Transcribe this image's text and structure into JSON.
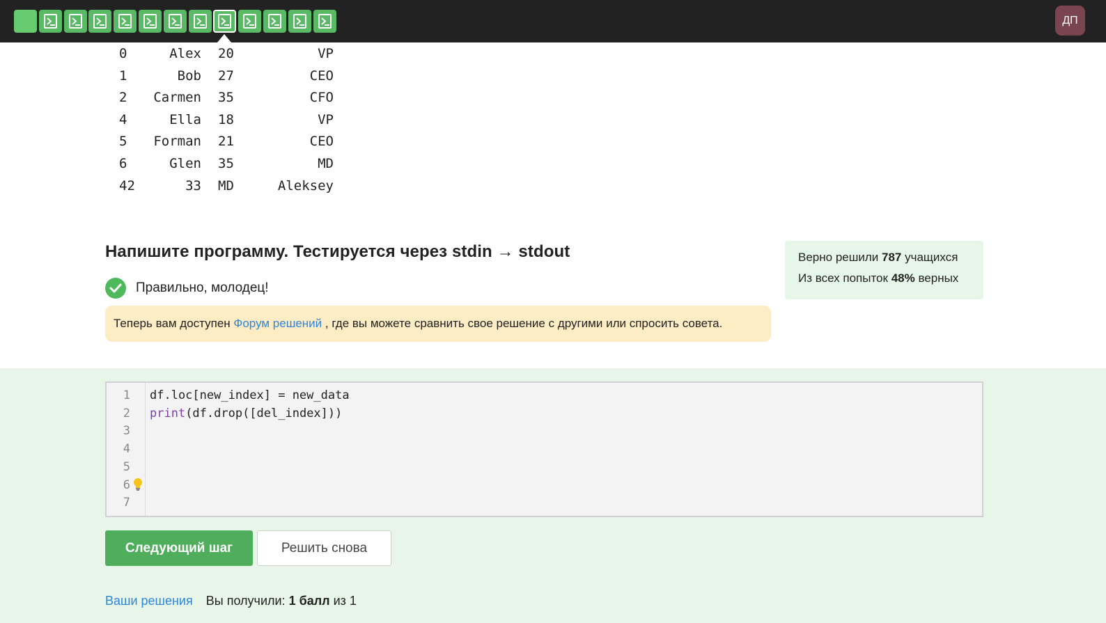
{
  "topbar": {
    "steps": [
      {
        "type": "done",
        "icon": "step-blank-icon"
      },
      {
        "type": "done",
        "icon": "terminal-icon"
      },
      {
        "type": "done",
        "icon": "terminal-icon"
      },
      {
        "type": "done",
        "icon": "terminal-icon"
      },
      {
        "type": "done",
        "icon": "terminal-icon"
      },
      {
        "type": "done",
        "icon": "terminal-icon"
      },
      {
        "type": "done",
        "icon": "terminal-icon"
      },
      {
        "type": "done",
        "icon": "terminal-icon"
      },
      {
        "type": "current",
        "icon": "terminal-icon"
      },
      {
        "type": "done",
        "icon": "terminal-icon"
      },
      {
        "type": "done",
        "icon": "terminal-icon"
      },
      {
        "type": "done",
        "icon": "terminal-icon"
      },
      {
        "type": "done",
        "icon": "terminal-icon"
      }
    ],
    "avatar_initials": "ДП"
  },
  "output_table": {
    "rows": [
      [
        "0",
        "Alex",
        "20",
        "VP"
      ],
      [
        "1",
        "Bob",
        "27",
        "CEO"
      ],
      [
        "2",
        "Carmen",
        "35",
        "CFO"
      ],
      [
        "4",
        "Ella",
        "18",
        "VP"
      ],
      [
        "5",
        "Forman",
        "21",
        "CEO"
      ],
      [
        "6",
        "Glen",
        "35",
        "MD"
      ],
      [
        "42",
        "33",
        "MD",
        "Aleksey"
      ]
    ]
  },
  "task": {
    "title": "Напишите программу. Тестируется через stdin → stdout",
    "result_text": "Правильно, молодец!",
    "notice_before": "Теперь вам доступен",
    "notice_link": "Форум решений",
    "notice_after": ", где вы можете сравнить свое решение с другими или спросить совета."
  },
  "stats": {
    "solved_prefix": "Верно решили",
    "solved_count": "787",
    "solved_suffix": "учащихся",
    "attempts_prefix": "Из всех попыток",
    "attempts_percent": "48%",
    "attempts_suffix": "верных"
  },
  "editor": {
    "line_numbers": [
      "1",
      "2",
      "3",
      "4",
      "5",
      "6",
      "7"
    ],
    "lines": [
      {
        "kw": "",
        "rest": "df.loc[new_index] = new_data"
      },
      {
        "kw": "print",
        "rest": "(df.drop([del_index]))"
      }
    ]
  },
  "buttons": {
    "next_step": "Следующий шаг",
    "solve_again": "Решить снова"
  },
  "footer": {
    "your_solutions": "Ваши решения",
    "received_prefix": "Вы получили:",
    "score": "1 балл",
    "of": "из 1"
  },
  "colors": {
    "topbar_bg": "#222222",
    "step_green": "#59b964",
    "success_green": "#4eb85b",
    "notice_bg": "#fdecc4",
    "stats_bg": "#e6f6e8",
    "lower_bg": "#e8f6ea",
    "link": "#2f86d8",
    "avatar_bg": "#7a4450"
  }
}
